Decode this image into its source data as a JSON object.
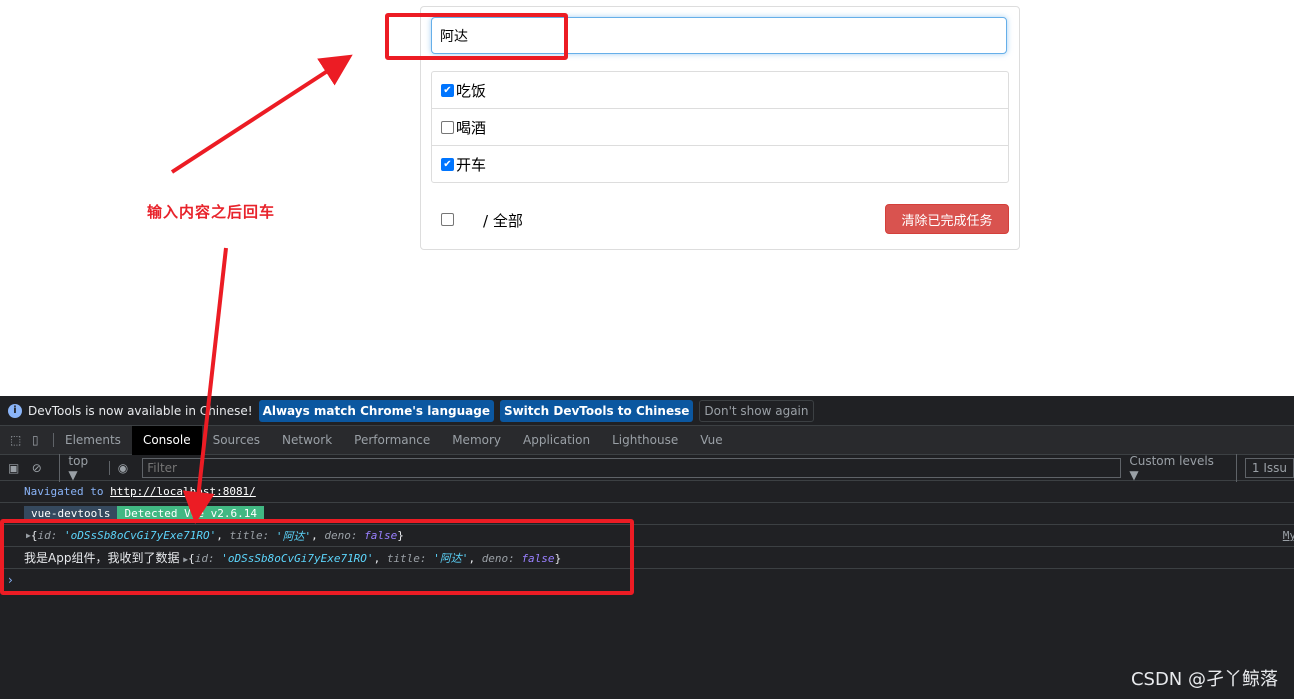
{
  "app": {
    "input_value": "阿达",
    "todos": [
      {
        "title": "吃饭",
        "done": true
      },
      {
        "title": "喝酒",
        "done": false
      },
      {
        "title": "开车",
        "done": true
      }
    ],
    "footer": {
      "label": "/ 全部",
      "select_all_checked": false,
      "clear_button": "清除已完成任务"
    }
  },
  "annotation": {
    "note": "输入内容之后回车",
    "watermark": "CSDN @孑丫鲸落",
    "color": "#ec1c24"
  },
  "devtools": {
    "infobar": {
      "message": "DevTools is now available in Chinese!",
      "btn_match": "Always match Chrome's language",
      "btn_switch": "Switch DevTools to Chinese",
      "btn_dismiss": "Don't show again"
    },
    "tabs": [
      "Elements",
      "Console",
      "Sources",
      "Network",
      "Performance",
      "Memory",
      "Application",
      "Lighthouse",
      "Vue"
    ],
    "active_tab": "Console",
    "toolbar": {
      "context": "top",
      "filter_placeholder": "Filter",
      "levels": "Custom levels",
      "issues": "1 Issu"
    },
    "console": {
      "nav_text": "Navigated to",
      "nav_url": "http://localhost:8081/",
      "badge_left": "vue-devtools",
      "badge_right": "Detected Vue v2.6.14",
      "log1": {
        "id": "'oDSsSb8oCvGi7yExe71RO'",
        "title": "'阿达'",
        "deno": "false",
        "source": "My"
      },
      "log2_prefix": "我是App组件，我收到了数据",
      "log2": {
        "id": "'oDSsSb8oCvGi7yExe71RO'",
        "title": "'阿达'",
        "deno": "false"
      }
    }
  }
}
